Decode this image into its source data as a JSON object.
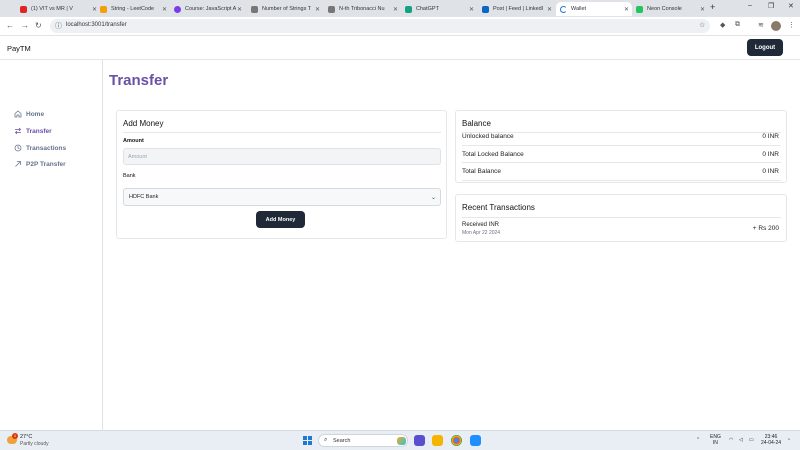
{
  "browser": {
    "tabs": [
      {
        "label": "(1) VIT vs MR | V",
        "color": "#e02424"
      },
      {
        "label": "String - LeetCode",
        "color": "#f59e0b"
      },
      {
        "label": "Course: JavaScript A",
        "color": "#7c3aed"
      },
      {
        "label": "Number of Strings T",
        "color": "#444444"
      },
      {
        "label": "N-th Tribonacci Nu",
        "color": "#444444"
      },
      {
        "label": "ChatGPT",
        "color": "#10a37f"
      },
      {
        "label": "Post | Feed | LinkedI",
        "color": "#0a66c2"
      },
      {
        "label": "Wallet",
        "color": "#1f78d1"
      },
      {
        "label": "Neon Console",
        "color": "#22c55e"
      }
    ],
    "url": "localhost:3001/transfer"
  },
  "app": {
    "brand": "PayTM",
    "logout_label": "Logout"
  },
  "sidebar": {
    "items": [
      {
        "label": "Home",
        "icon": "home-icon"
      },
      {
        "label": "Transfer",
        "icon": "transfer-arrows-icon",
        "active": true
      },
      {
        "label": "Transactions",
        "icon": "clock-icon"
      },
      {
        "label": "P2P Transfer",
        "icon": "arrow-up-right-icon"
      }
    ]
  },
  "main": {
    "title": "Transfer",
    "add_money": {
      "title": "Add Money",
      "amount_label": "Amount",
      "amount_placeholder": "Amount",
      "bank_label": "Bank",
      "bank_selected": "HDFC Bank",
      "button_label": "Add Money"
    },
    "balance": {
      "title": "Balance",
      "rows": [
        {
          "label": "Unlocked balance",
          "value": "0 INR"
        },
        {
          "label": "Total Locked Balance",
          "value": "0 INR"
        },
        {
          "label": "Total Balance",
          "value": "0 INR"
        }
      ]
    },
    "recent": {
      "title": "Recent Transactions",
      "items": [
        {
          "title": "Received INR",
          "date": "Mon Apr 22 2024",
          "amount": "+ Rs 200"
        }
      ]
    }
  },
  "taskbar": {
    "temperature": "27°C",
    "weather": "Partly cloudy",
    "weather_badge": "1",
    "search_label": "Search",
    "language_line1": "ENG",
    "language_line2": "IN",
    "time": "23:46",
    "date": "24-04-24"
  },
  "colors": {
    "accent": "#6a51a6",
    "dark_button": "#1f2937"
  }
}
